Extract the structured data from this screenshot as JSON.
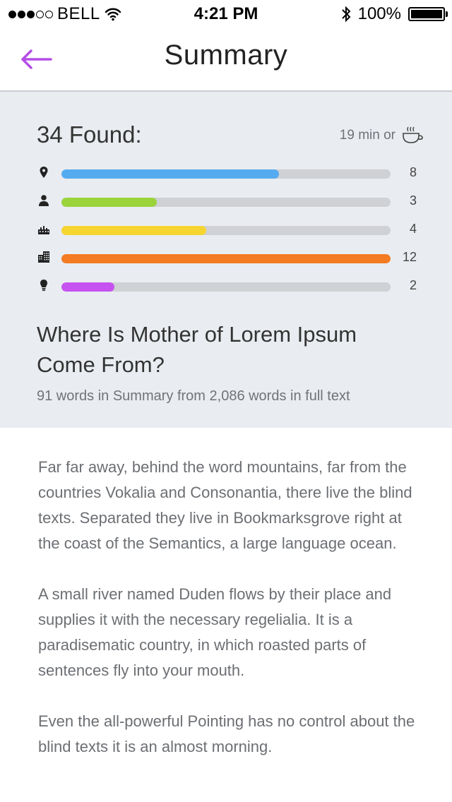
{
  "status_bar": {
    "carrier": "BELL",
    "time": "4:21 PM",
    "battery": "100%",
    "signal_bars_filled": 3,
    "signal_bars_total": 5
  },
  "nav": {
    "title": "Summary",
    "back_icon": "back-arrow-icon",
    "accent": "#b44ee6"
  },
  "summary": {
    "found": "34 Found:",
    "read_time": "19 min or",
    "read_time_icon": "coffee-cup-icon",
    "stats": [
      {
        "icon": "location-pin-icon",
        "count": "8",
        "fraction": 0.66,
        "color": "#55abf0"
      },
      {
        "icon": "person-icon",
        "count": "3",
        "fraction": 0.29,
        "color": "#9ad33a"
      },
      {
        "icon": "city-skyline-icon",
        "count": "4",
        "fraction": 0.44,
        "color": "#f6d531"
      },
      {
        "icon": "building-icon",
        "count": "12",
        "fraction": 1.0,
        "color": "#f47b22"
      },
      {
        "icon": "light-bulb-icon",
        "count": "2",
        "fraction": 0.16,
        "color": "#c653ef"
      }
    ],
    "title": "Where Is Mother of Lorem Ipsum Come From?",
    "word_count": "91 words in Summary from 2,086 words in full text"
  },
  "content": {
    "paragraphs": [
      "Far far away, behind the word mountains, far from the countries Vokalia and Consonantia, there live the blind texts. Separated they live in Bookmarksgrove right at the coast of the Semantics, a large language ocean.",
      "A small river named Duden flows by their place and supplies it with the necessary regelialia. It is a paradisematic country, in which roasted parts of sentences fly into your mouth.",
      "Even the all-powerful Pointing has no control about the blind texts it is an almost morning."
    ]
  }
}
